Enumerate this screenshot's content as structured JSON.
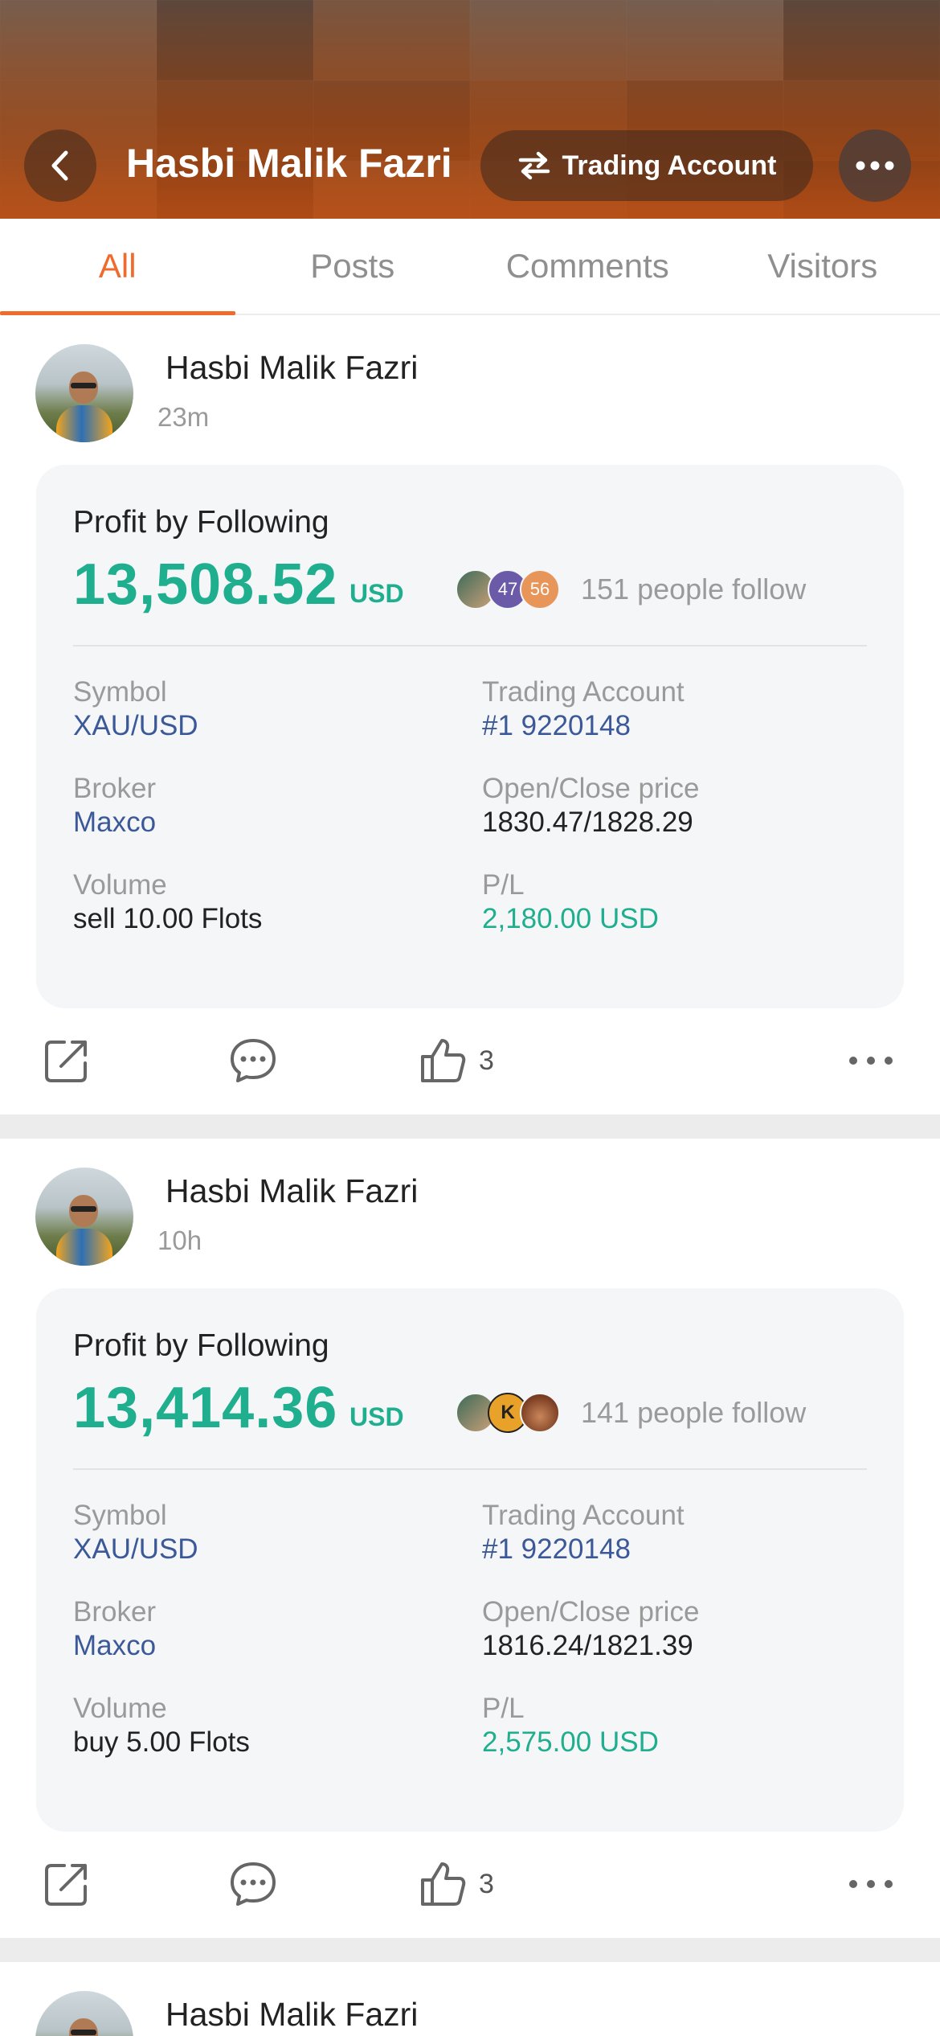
{
  "header": {
    "profile_name": "Hasbi Malik Fazri",
    "trading_account_label": "Trading Account"
  },
  "tabs": [
    {
      "label": "All",
      "active": true
    },
    {
      "label": "Posts",
      "active": false
    },
    {
      "label": "Comments",
      "active": false
    },
    {
      "label": "Visitors",
      "active": false
    }
  ],
  "posts": [
    {
      "author": "Hasbi Malik Fazri",
      "time": "23m",
      "card_title": "Profit by Following",
      "profit": "13,508.52",
      "currency": "USD",
      "follower_badges": [
        "47",
        "56"
      ],
      "follow_text": "151 people follow",
      "symbol_label": "Symbol",
      "symbol": "XAU/USD",
      "account_label": "Trading Account",
      "account": "#1 9220148",
      "broker_label": "Broker",
      "broker": "Maxco",
      "price_label": "Open/Close price",
      "price": "1830.47/1828.29",
      "volume_label": "Volume",
      "volume": "sell 10.00 Flots",
      "pl_label": "P/L",
      "pl": "2,180.00 USD",
      "likes": "3"
    },
    {
      "author": "Hasbi Malik Fazri",
      "time": "10h",
      "card_title": "Profit by Following",
      "profit": "13,414.36",
      "currency": "USD",
      "follower_badges": [
        "",
        ""
      ],
      "follow_text": "141 people follow",
      "symbol_label": "Symbol",
      "symbol": "XAU/USD",
      "account_label": "Trading Account",
      "account": "#1 9220148",
      "broker_label": "Broker",
      "broker": "Maxco",
      "price_label": "Open/Close price",
      "price": "1816.24/1821.39",
      "volume_label": "Volume",
      "volume": "buy 5.00 Flots",
      "pl_label": "P/L",
      "pl": "2,575.00 USD",
      "likes": "3"
    },
    {
      "author": "Hasbi Malik Fazri"
    }
  ],
  "colors": {
    "accent": "#ef6a2c",
    "profit_green": "#1fae8e",
    "link_blue": "#3b5998"
  }
}
